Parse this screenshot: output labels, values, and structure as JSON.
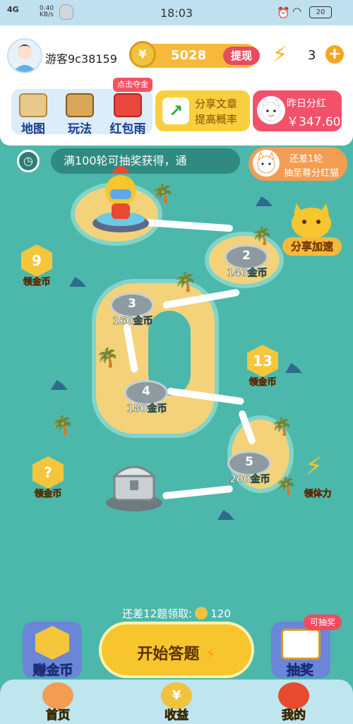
{
  "status_bar": {
    "network": "4G",
    "speed_value": "0.40",
    "speed_unit": "KB/s",
    "time": "18:03",
    "battery": "20"
  },
  "header": {
    "username": "游客9c38159",
    "coins": "5028",
    "withdraw_label": "提现",
    "energy": "3",
    "menu": [
      {
        "label": "地图"
      },
      {
        "label": "玩法"
      },
      {
        "label": "红包雨"
      }
    ],
    "hint_label": "点击夺金",
    "share": {
      "line1": "分享文章",
      "line2": "提高概率"
    },
    "bonus": {
      "line1": "昨日分红",
      "line2": "￥347.60"
    }
  },
  "ticker": {
    "text": "满100轮可抽奖获得，通",
    "cat_line1": "还差1轮",
    "cat_line2": "抽至尊分红猫"
  },
  "map": {
    "share_speed": "分享加速",
    "stations": [
      {
        "num": "2",
        "coins": "140金币"
      },
      {
        "num": "3",
        "coins": "160金币"
      },
      {
        "num": "4",
        "coins": "180金币"
      },
      {
        "num": "5",
        "coins": "200金币"
      }
    ],
    "badges": [
      {
        "num": "9",
        "label": "领金币"
      },
      {
        "num": "13",
        "label": "领金币"
      },
      {
        "num": "?",
        "label": "领金币"
      }
    ],
    "energy_label": "领体力"
  },
  "bottom": {
    "remaining_prefix": "还差12题领取:",
    "remaining_coins": "120",
    "start_label": "开始答题",
    "earn_label": "赚金币",
    "lottery_label": "抽奖",
    "lottery_tag": "可抽奖"
  },
  "tabs": [
    {
      "label": "首页"
    },
    {
      "label": "收益"
    },
    {
      "label": "我的"
    }
  ],
  "colors": {
    "sea": "#4cb8ac",
    "sand": "#f4d27a",
    "gold": "#f7c52e",
    "red": "#e84a5f"
  }
}
